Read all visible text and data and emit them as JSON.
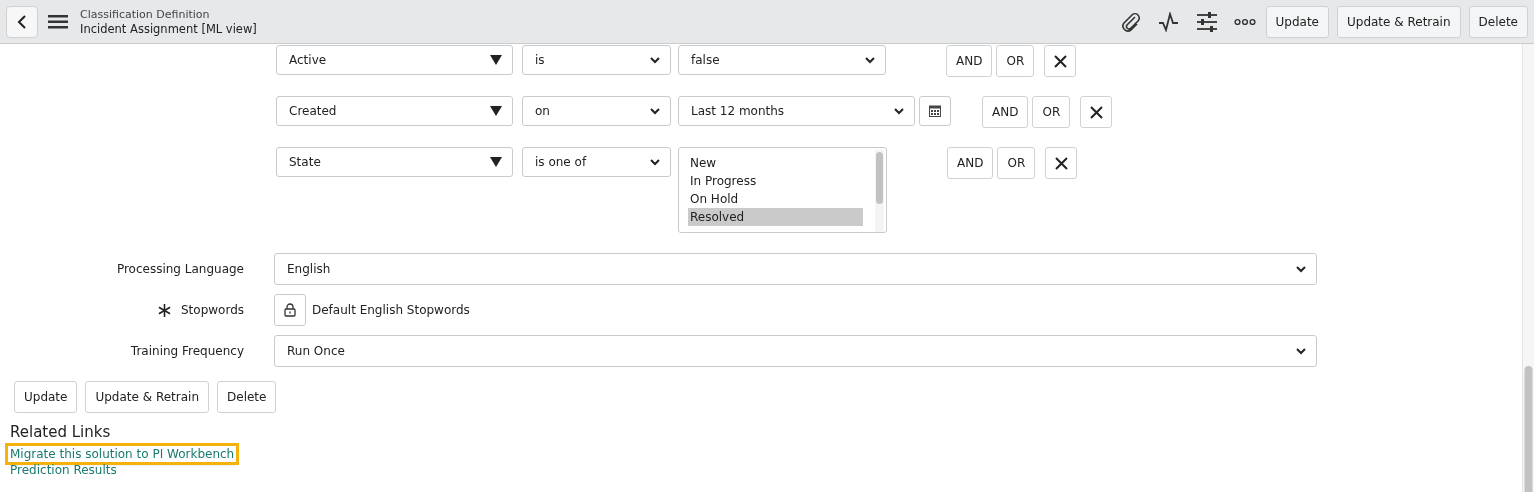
{
  "header": {
    "subtitle": "Classification Definition",
    "title": "Incident Assignment [ML view]",
    "buttons": [
      "Update",
      "Update & Retrain",
      "Delete"
    ]
  },
  "conditions": [
    {
      "kind": "select",
      "field": "Active",
      "operator": "is",
      "value": "false",
      "actions": [
        "AND",
        "OR"
      ]
    },
    {
      "kind": "date",
      "field": "Created",
      "operator": "on",
      "value": "Last 12 months",
      "actions": [
        "AND",
        "OR"
      ]
    },
    {
      "kind": "list",
      "field": "State",
      "operator": "is one of",
      "options": [
        {
          "label": "New",
          "selected": false
        },
        {
          "label": "In Progress",
          "selected": false
        },
        {
          "label": "On Hold",
          "selected": false
        },
        {
          "label": "Resolved",
          "selected": true
        }
      ],
      "actions": [
        "AND",
        "OR"
      ]
    }
  ],
  "form": [
    {
      "kind": "select",
      "label": "Processing Language",
      "required": false,
      "value": "English"
    },
    {
      "kind": "locked",
      "label": "Stopwords",
      "required": true,
      "value": "Default English Stopwords"
    },
    {
      "kind": "select",
      "label": "Training Frequency",
      "required": false,
      "value": "Run Once"
    }
  ],
  "buttons": [
    "Update",
    "Update & Retrain",
    "Delete"
  ],
  "related_links": {
    "title": "Related Links",
    "links": [
      {
        "label": "Migrate this solution to PI Workbench",
        "focused": true
      },
      {
        "label": "Prediction Results",
        "focused": false
      }
    ]
  }
}
